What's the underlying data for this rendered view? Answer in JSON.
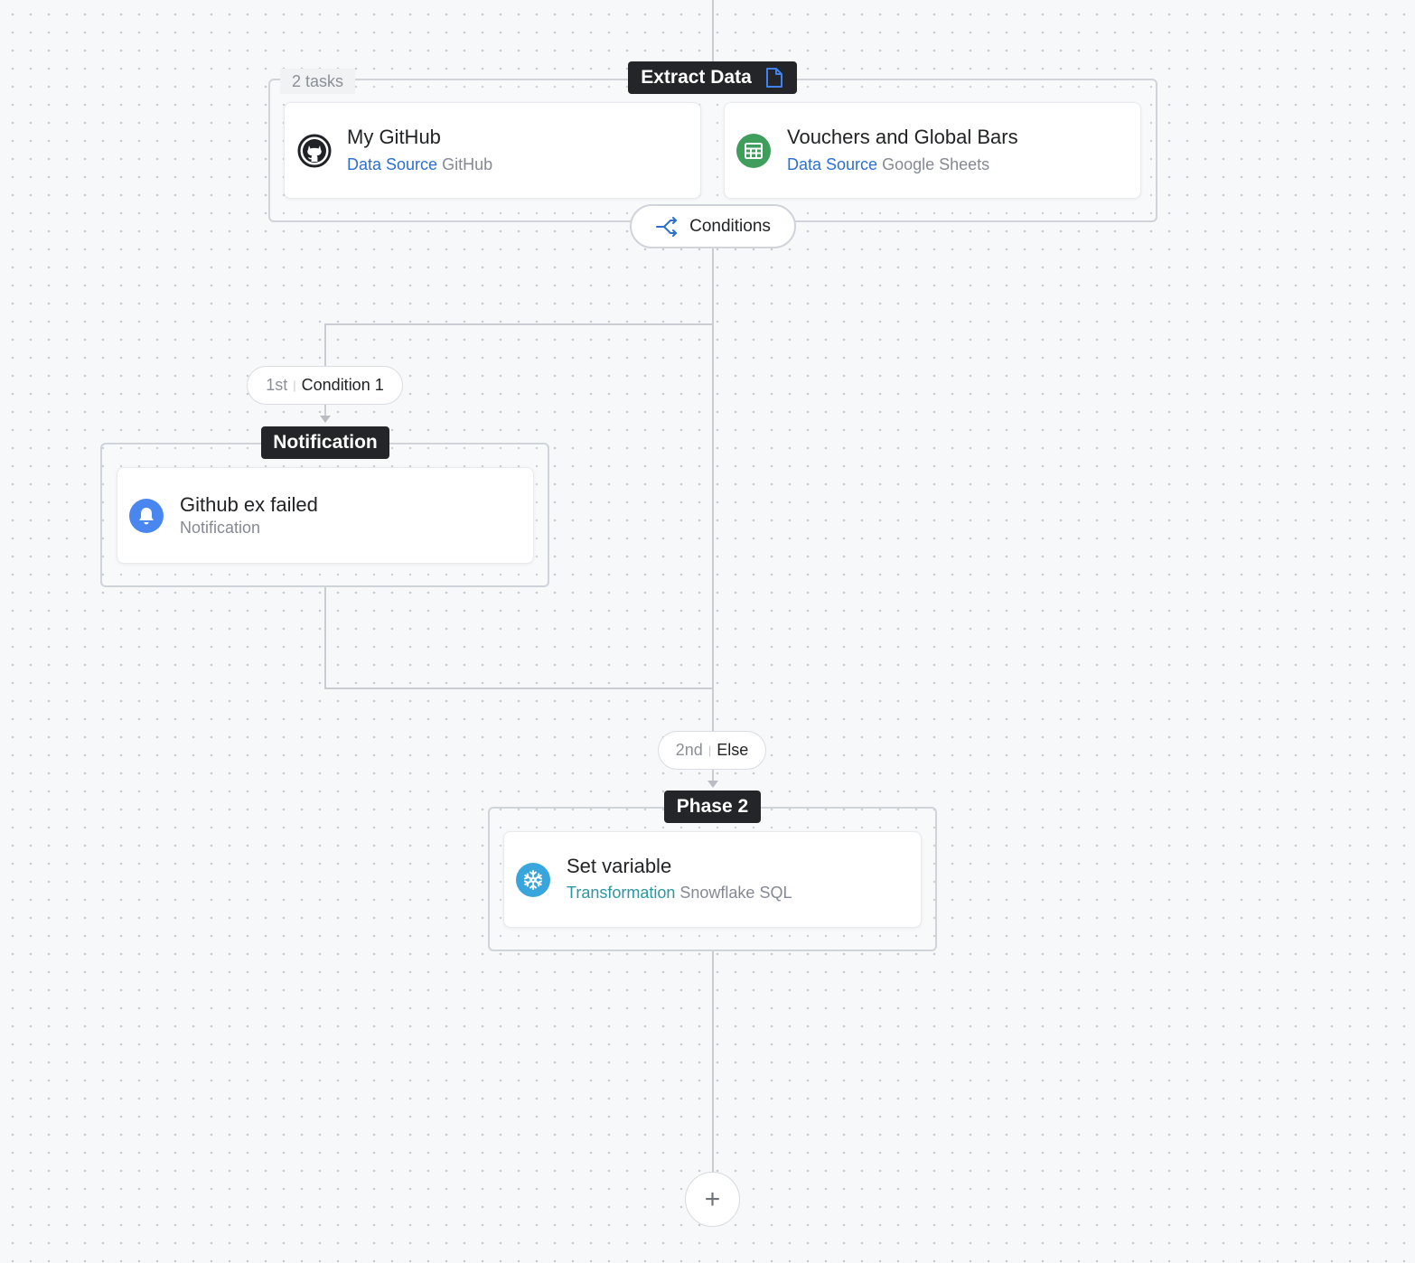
{
  "phases": [
    {
      "name": "Extract Data",
      "task_count": "2 tasks",
      "tasks": [
        {
          "title": "My GitHub",
          "kind": "Data Source",
          "service": "GitHub",
          "icon": "github-icon"
        },
        {
          "title": "Vouchers and Global Bars",
          "kind": "Data Source",
          "service": "Google Sheets",
          "icon": "google-sheets-icon"
        }
      ]
    },
    {
      "name": "Notification",
      "tasks": [
        {
          "title": "Github ex failed",
          "kind": "Notification",
          "icon": "bell-icon"
        }
      ]
    },
    {
      "name": "Phase 2",
      "tasks": [
        {
          "title": "Set variable",
          "kind": "Transformation",
          "service": "Snowflake SQL",
          "icon": "snowflake-icon"
        }
      ]
    }
  ],
  "conditions_button": {
    "label": "Conditions",
    "icon": "split-arrows-icon"
  },
  "branches": [
    {
      "order": "1st",
      "label": "Condition 1"
    },
    {
      "order": "2nd",
      "label": "Else"
    }
  ],
  "add_button": {
    "label": "+",
    "icon": "plus-icon"
  },
  "colors": {
    "accent_blue": "#2d6fce",
    "transformation_teal": "#2a96a0",
    "phase_label_bg": "#232528",
    "sheets_green": "#3f9e5c",
    "bell_blue": "#4a86f0",
    "snowflake_blue": "#38a6dc"
  }
}
